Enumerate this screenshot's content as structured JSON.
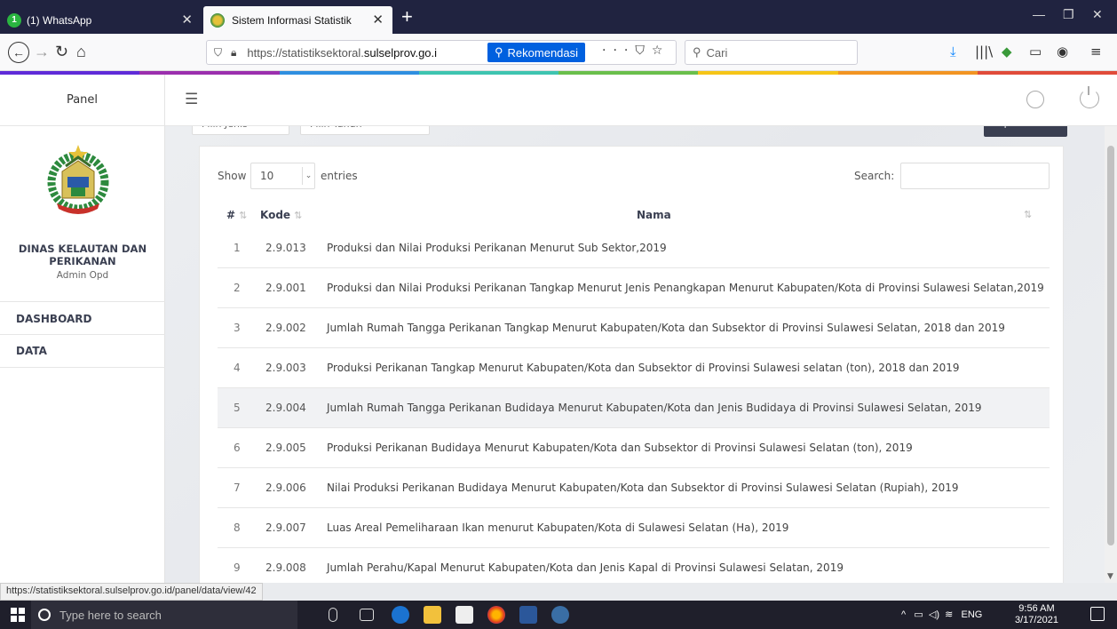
{
  "browser": {
    "tabs": [
      {
        "title": "(1) WhatsApp",
        "badge": "1"
      },
      {
        "title": "Sistem Informasi Statistik"
      }
    ],
    "new_tab": "+",
    "url_prefix": "https://statistiksektoral.",
    "url_domain": "sulselprov.go.i",
    "rekomendasi": "Rekomendasi",
    "search_placeholder": "Cari",
    "status_url": "https://statistiksektoral.sulselprov.go.id/panel/data/view/42"
  },
  "colors": {
    "strip": [
      "#5f2bd8",
      "#9b2fae",
      "#2f8fe0",
      "#3ec4b0",
      "#6abf4b",
      "#f5c518",
      "#f29422",
      "#e04b3a"
    ],
    "sidebar_text": "#3a3f51",
    "row_highlight": "#f1f2f4",
    "rekomendasi_bg": "#0060df"
  },
  "sidebar": {
    "panel_title": "Panel",
    "org_name": "DINAS KELAUTAN DAN PERIKANAN",
    "role": "Admin Opd",
    "menu": [
      {
        "label": "DASHBOARD"
      },
      {
        "label": "DATA"
      }
    ]
  },
  "filters": {
    "jenis_placeholder": "Pilih Jenis",
    "tahun_placeholder": "Pilih Tahun",
    "import_label": "Import Data"
  },
  "table": {
    "show_label": "Show",
    "page_size": "10",
    "entries_label": "entries",
    "search_label": "Search:",
    "columns": [
      "#",
      "Kode",
      "Nama"
    ],
    "rows": [
      {
        "no": "1",
        "kode": "2.9.013",
        "nama": "Produksi dan Nilai Produksi Perikanan Menurut Sub Sektor,2019"
      },
      {
        "no": "2",
        "kode": "2.9.001",
        "nama": "Produksi dan Nilai Produksi Perikanan Tangkap Menurut Jenis Penangkapan Menurut Kabupaten/Kota di Provinsi Sulawesi Selatan,2019"
      },
      {
        "no": "3",
        "kode": "2.9.002",
        "nama": "Jumlah Rumah Tangga Perikanan Tangkap Menurut Kabupaten/Kota dan Subsektor di Provinsi Sulawesi Selatan, 2018 dan 2019"
      },
      {
        "no": "4",
        "kode": "2.9.003",
        "nama": "Produksi Perikanan Tangkap Menurut Kabupaten/Kota dan Subsektor di Provinsi Sulawesi selatan (ton), 2018 dan 2019"
      },
      {
        "no": "5",
        "kode": "2.9.004",
        "nama": "Jumlah Rumah Tangga Perikanan Budidaya Menurut Kabupaten/Kota dan Jenis Budidaya di Provinsi Sulawesi Selatan, 2019"
      },
      {
        "no": "6",
        "kode": "2.9.005",
        "nama": "Produksi Perikanan Budidaya Menurut Kabupaten/Kota dan Subsektor di Provinsi Sulawesi Selatan (ton), 2019"
      },
      {
        "no": "7",
        "kode": "2.9.006",
        "nama": "Nilai Produksi Perikanan Budidaya Menurut Kabupaten/Kota dan Subsektor di Provinsi Sulawesi Selatan (Rupiah), 2019"
      },
      {
        "no": "8",
        "kode": "2.9.007",
        "nama": "Luas Areal Pemeliharaan Ikan menurut Kabupaten/Kota di Sulawesi Selatan (Ha), 2019"
      },
      {
        "no": "9",
        "kode": "2.9.008",
        "nama": "Jumlah Perahu/Kapal Menurut Kabupaten/Kota dan Jenis Kapal di Provinsi Sulawesi Selatan, 2019"
      }
    ]
  },
  "taskbar": {
    "search_placeholder": "Type here to search",
    "lang": "ENG",
    "time": "9:56 AM",
    "date": "3/17/2021"
  }
}
